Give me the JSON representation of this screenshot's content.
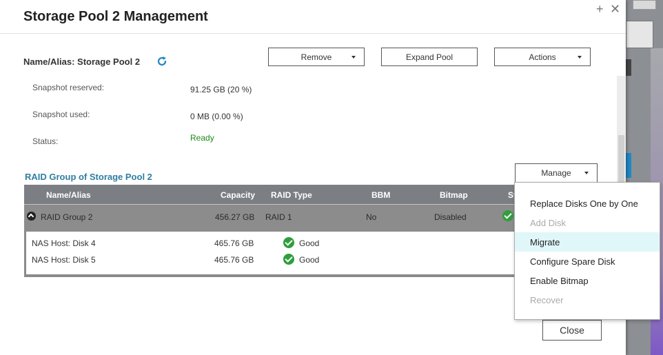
{
  "dialog": {
    "title": "Storage Pool 2 Management",
    "name_alias": "Name/Alias: Storage Pool 2",
    "win_plus": "+",
    "win_close": "✕"
  },
  "toolbar": {
    "remove_label": "Remove",
    "expand_label": "Expand Pool",
    "actions_label": "Actions"
  },
  "info": [
    {
      "label": "Snapshot reserved:",
      "value": "91.25 GB (20 %)"
    },
    {
      "label": "Snapshot used:",
      "value": "0 MB (0.00 %)"
    },
    {
      "label": "Status:",
      "value": "Ready"
    }
  ],
  "raid_section": {
    "title": "RAID Group of Storage Pool 2",
    "manage_label": "Manage",
    "columns": [
      "Name/Alias",
      "Capacity",
      "RAID Type",
      "BBM",
      "Bitmap",
      "St"
    ],
    "group": {
      "name": "RAID Group 2",
      "capacity": "456.27 GB",
      "raid_type": "RAID 1",
      "bbm": "No",
      "bitmap": "Disabled"
    },
    "disks": [
      {
        "name": "NAS Host: Disk 4",
        "capacity": "465.76 GB",
        "status": "Good"
      },
      {
        "name": "NAS Host: Disk 5",
        "capacity": "465.76 GB",
        "status": "Good"
      }
    ]
  },
  "manage_menu": {
    "items": [
      {
        "label": "Replace Disks One by One",
        "disabled": false
      },
      {
        "label": "Add Disk",
        "disabled": true
      },
      {
        "label": "Migrate",
        "disabled": false,
        "hover": true
      },
      {
        "label": "Configure Spare Disk",
        "disabled": false
      },
      {
        "label": "Enable Bitmap",
        "disabled": false
      },
      {
        "label": "Recover",
        "disabled": true
      }
    ]
  },
  "footer": {
    "close_label": "Close"
  },
  "colors": {
    "accent": "#2e7fa0",
    "status_ok": "#1a8a1a",
    "menu_hover": "#e0f7fa"
  }
}
